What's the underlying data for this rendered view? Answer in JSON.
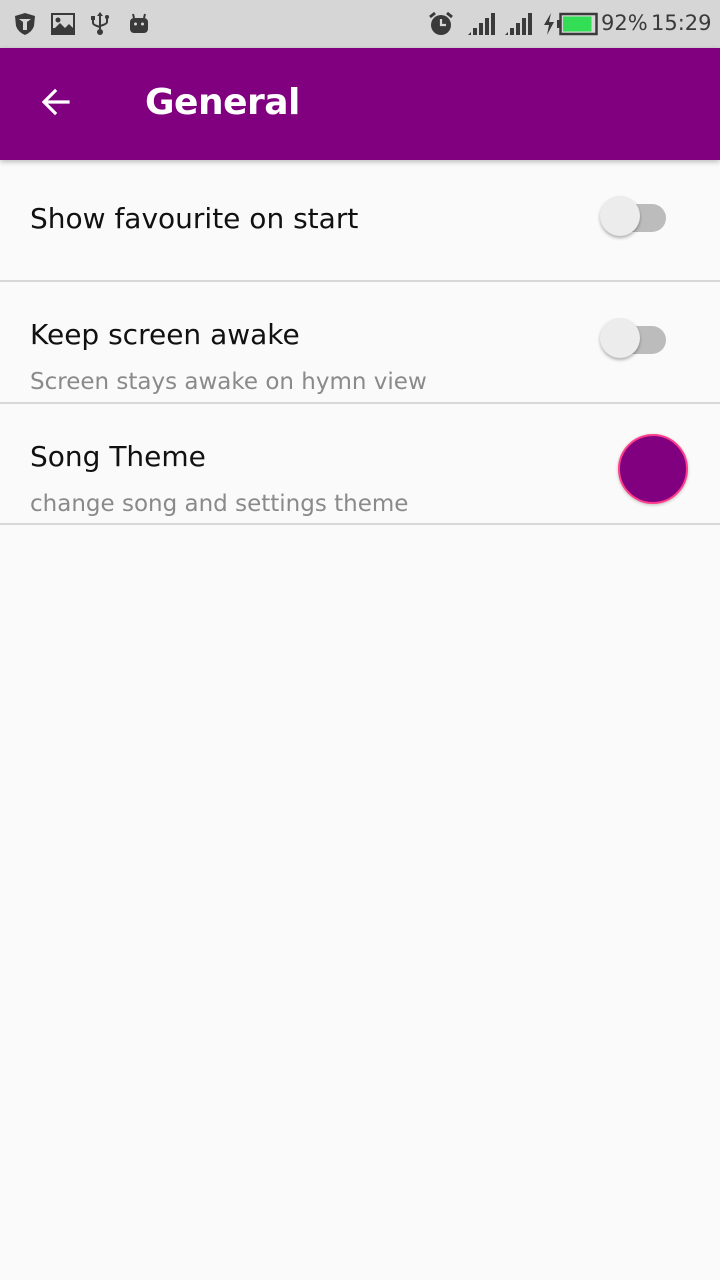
{
  "status_bar": {
    "left_icons": [
      "shield-icon",
      "image-icon",
      "usb-icon",
      "android-debug-icon"
    ],
    "right_icons": [
      "alarm-icon",
      "signal-icon",
      "signal-icon",
      "charging-icon",
      "battery-icon"
    ],
    "battery_percent": "92%",
    "battery_level": 0.92,
    "battery_color": "#33dd55",
    "time": "15:29"
  },
  "app_bar": {
    "title": "General",
    "back_icon": "arrow-back-icon",
    "color": "#800080"
  },
  "preferences": [
    {
      "title": "Show favourite on start",
      "summary": "",
      "type": "switch",
      "checked": false
    },
    {
      "title": "Keep screen awake",
      "summary": "Screen stays awake on hymn view",
      "type": "switch",
      "checked": false
    },
    {
      "title": "Song Theme",
      "summary": "change song and settings theme",
      "type": "color",
      "color": "#800080",
      "border_color": "#ff3d8a"
    }
  ]
}
